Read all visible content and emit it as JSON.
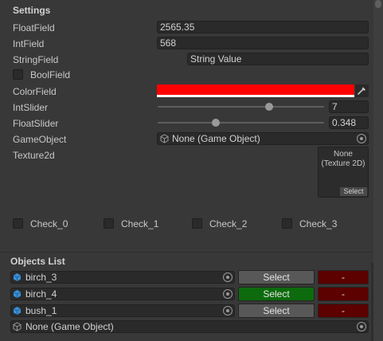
{
  "settings": {
    "header": "Settings",
    "float_field": {
      "label": "FloatField",
      "value": "2565.35"
    },
    "int_field": {
      "label": "IntField",
      "value": "568"
    },
    "string_field": {
      "label": "StringField",
      "value": "String Value"
    },
    "bool_field": {
      "label": "BoolField",
      "checked": false
    },
    "color_field": {
      "label": "ColorField",
      "value": "#ff0000"
    },
    "int_slider": {
      "label": "IntSlider",
      "value": "7",
      "fraction": 0.67
    },
    "float_slider": {
      "label": "FloatSlider",
      "value": "0.348",
      "fraction": 0.35
    },
    "game_object": {
      "label": "GameObject",
      "value": "None (Game Object)"
    },
    "texture2d": {
      "label": "Texture2d",
      "value_line1": "None",
      "value_line2": "(Texture 2D)",
      "select_label": "Select"
    }
  },
  "checks": [
    {
      "label": "Check_0",
      "checked": false
    },
    {
      "label": "Check_1",
      "checked": false
    },
    {
      "label": "Check_2",
      "checked": false
    },
    {
      "label": "Check_3",
      "checked": false
    }
  ],
  "objects_list": {
    "header": "Objects List",
    "items": [
      {
        "name": "birch_3",
        "select_label": "Select",
        "remove_label": "-",
        "selected": false
      },
      {
        "name": "birch_4",
        "select_label": "Select",
        "remove_label": "-",
        "selected": true
      },
      {
        "name": "bush_1",
        "select_label": "Select",
        "remove_label": "-",
        "selected": false
      }
    ],
    "new_item": {
      "value": "None (Game Object)"
    }
  },
  "colors": {
    "background": "#383838",
    "field_bg": "#2a2a2a",
    "selected_button": "#0d6b0d",
    "remove_button": "#5c0000",
    "prefab_icon": "#3a8fd6"
  },
  "icons": {
    "object_picker": "target-circle-icon",
    "eyedropper": "eyedropper-icon",
    "prefab": "cube-icon"
  }
}
